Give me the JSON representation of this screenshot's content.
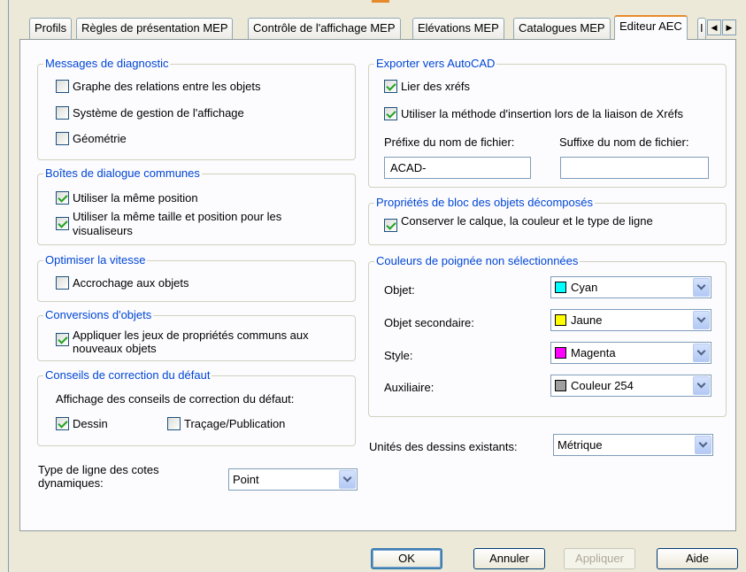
{
  "tabs": [
    "Profils",
    "Règles de présentation MEP",
    "Contrôle de l'affichage MEP",
    "Elévations MEP",
    "Catalogues MEP",
    "Editeur AEC",
    "I"
  ],
  "tab_scroll": {
    "left": "◀",
    "right": "▶"
  },
  "diag": {
    "title": "Messages de diagnostic",
    "items": [
      {
        "label": "Graphe des relations entre les objets",
        "checked": false
      },
      {
        "label": "Système de gestion de l'affichage",
        "checked": false
      },
      {
        "label": "Géométrie",
        "checked": false
      }
    ]
  },
  "dialogs": {
    "title": "Boîtes de dialogue communes",
    "items": [
      {
        "label": "Utiliser la même position",
        "checked": true
      },
      {
        "label": "Utiliser la même taille et position pour les visualiseurs",
        "checked": true
      }
    ]
  },
  "speed": {
    "title": "Optimiser la vitesse",
    "items": [
      {
        "label": "Accrochage aux objets",
        "checked": false
      }
    ]
  },
  "conversions": {
    "title": "Conversions d'objets",
    "items": [
      {
        "label": "Appliquer les jeux de propriétés communs aux nouveaux objets",
        "checked": true
      }
    ]
  },
  "fix": {
    "title": "Conseils de correction du défaut",
    "subtitle": "Affichage des conseils de correction du défaut:",
    "items": [
      {
        "label": "Dessin",
        "checked": true
      },
      {
        "label": "Traçage/Publication",
        "checked": false
      }
    ]
  },
  "linetype": {
    "label": "Type de ligne des cotes dynamiques:",
    "value": "Point"
  },
  "export": {
    "title": "Exporter vers AutoCAD",
    "items": [
      {
        "label": "Lier des xréfs",
        "checked": true
      },
      {
        "label": "Utiliser la méthode d'insertion lors de la liaison de Xréfs",
        "checked": true
      }
    ],
    "prefix_label": "Préfixe du nom de fichier:",
    "prefix_value": "ACAD-",
    "suffix_label": "Suffixe du nom de fichier:",
    "suffix_value": ""
  },
  "block": {
    "title": "Propriétés de bloc des objets décomposés",
    "items": [
      {
        "label": "Conserver le calque, la couleur et le type de ligne",
        "checked": true
      }
    ]
  },
  "grips": {
    "title": "Couleurs de poignée non sélectionnées",
    "rows": [
      {
        "label": "Objet:",
        "value": "Cyan",
        "color": "#00ffff"
      },
      {
        "label": "Objet secondaire:",
        "value": "Jaune",
        "color": "#ffff00"
      },
      {
        "label": "Style:",
        "value": "Magenta",
        "color": "#ff00ff"
      },
      {
        "label": "Auxiliaire:",
        "value": "Couleur 254",
        "color": "#a0a0a0"
      }
    ]
  },
  "units": {
    "label": "Unités des dessins existants:",
    "value": "Métrique"
  },
  "buttons": {
    "ok": "OK",
    "cancel": "Annuler",
    "apply": "Appliquer",
    "help": "Aide"
  }
}
